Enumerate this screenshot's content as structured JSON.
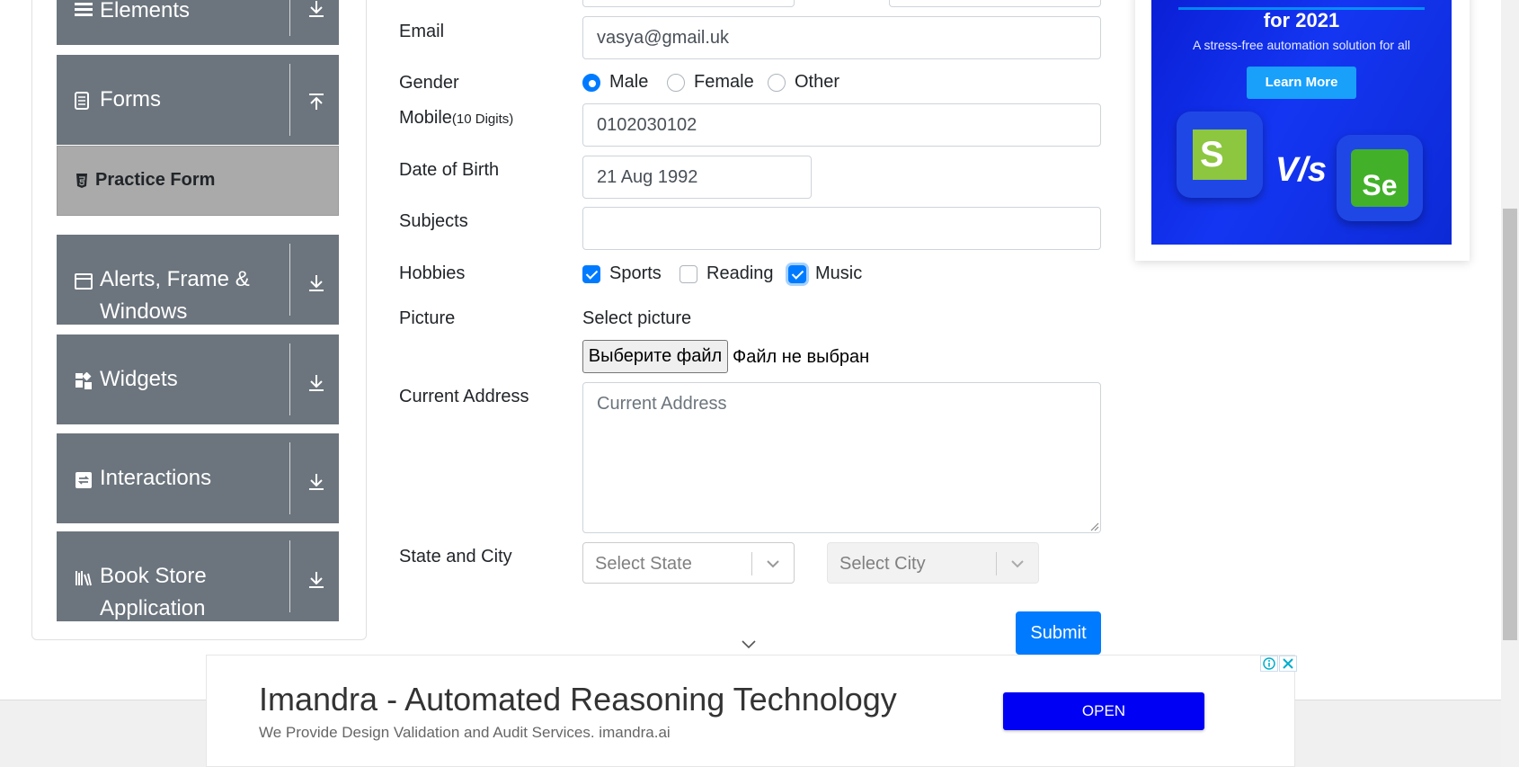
{
  "sidebar": {
    "groups": [
      {
        "label": "Elements",
        "icon": "hamburger-icon"
      },
      {
        "label": "Forms",
        "icon": "form-icon"
      },
      {
        "label": "Alerts, Frame & Windows",
        "label_line1": "Alerts, Frame &",
        "label_line2": "Windows",
        "icon": "window-icon"
      },
      {
        "label": "Widgets",
        "icon": "widgets-icon"
      },
      {
        "label": "Interactions",
        "icon": "interactions-icon"
      },
      {
        "label": "Book Store Application",
        "label_line1": "Book Store",
        "label_line2": "Application",
        "icon": "books-icon"
      }
    ],
    "active_item": "Practice Form"
  },
  "form": {
    "email_label": "Email",
    "email_value": "vasya@gmail.uk",
    "gender_label": "Gender",
    "gender_options": [
      "Male",
      "Female",
      "Other"
    ],
    "gender_selected": "Male",
    "mobile_label": "Mobile",
    "mobile_hint": "(10 Digits)",
    "mobile_value": "0102030102",
    "dob_label": "Date of Birth",
    "dob_value": "21 Aug 1992",
    "subjects_label": "Subjects",
    "subjects_value": "",
    "hobbies_label": "Hobbies",
    "hobbies": [
      {
        "label": "Sports",
        "checked": true
      },
      {
        "label": "Reading",
        "checked": false
      },
      {
        "label": "Music",
        "checked": true
      }
    ],
    "picture_label": "Picture",
    "picture_prompt": "Select picture",
    "file_button": "Выберите файл",
    "file_status": "Файл не выбран",
    "address_label": "Current Address",
    "address_placeholder": "Current Address",
    "state_city_label": "State and City",
    "state_placeholder": "Select State",
    "city_placeholder": "Select City",
    "submit_label": "Submit"
  },
  "side_ad": {
    "title": "for 2021",
    "subtitle": "A stress-free automation solution for all",
    "cta": "Learn More",
    "vs_text": "V/s",
    "logo_left": "S",
    "logo_right": "Se"
  },
  "bottom_ad": {
    "headline": "Imandra - Automated Reasoning Technology",
    "description": "We Provide Design Validation and Audit Services. imandra.ai",
    "open_label": "OPEN"
  },
  "colors": {
    "sidebar_group": "#6c757d",
    "active_item": "#aaaaaa",
    "primary": "#007bff",
    "ad_open": "#0000f5"
  }
}
